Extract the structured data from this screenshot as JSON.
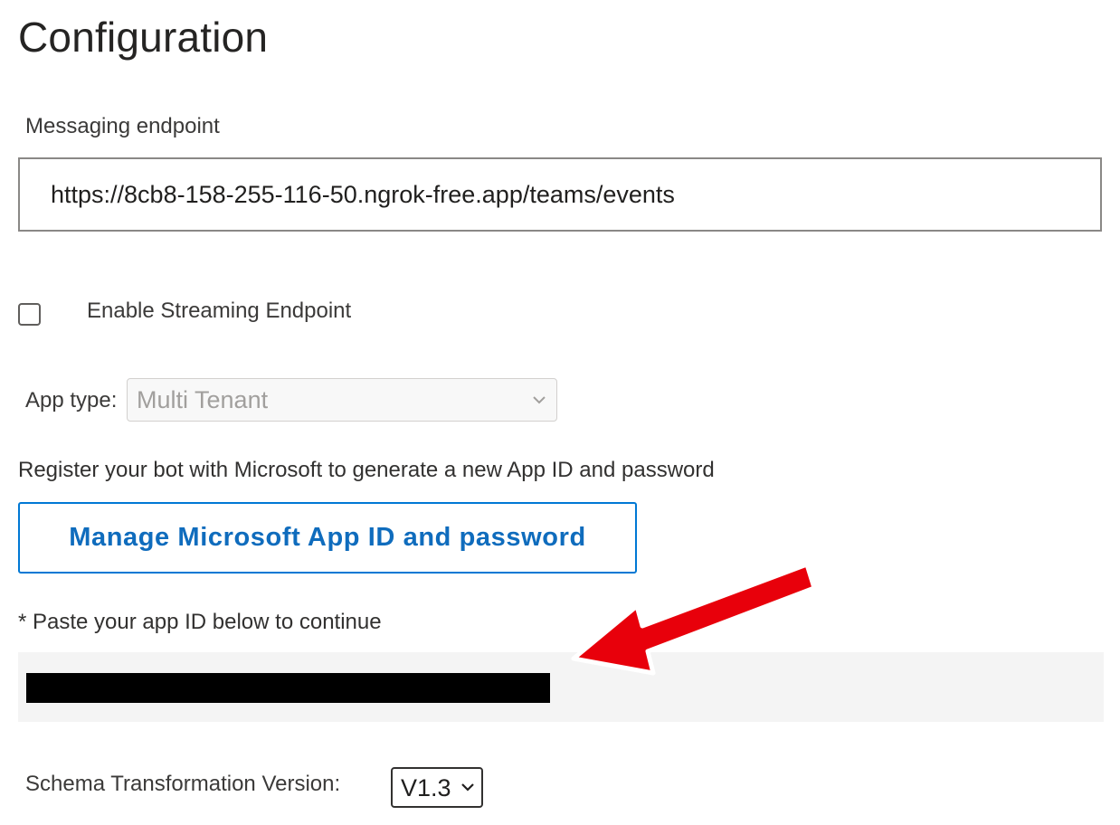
{
  "page": {
    "title": "Configuration"
  },
  "messaging_endpoint": {
    "label": "Messaging endpoint",
    "value": "https://8cb8-158-255-116-50.ngrok-free.app/teams/events"
  },
  "streaming": {
    "label": "Enable Streaming Endpoint",
    "checked": false
  },
  "app_type": {
    "label": "App type:",
    "selected": "Multi Tenant",
    "disabled": true,
    "icon": "chevron-down-icon"
  },
  "register": {
    "text": "Register your bot with Microsoft to generate a new App ID and password",
    "button_label": "Manage Microsoft App ID and password"
  },
  "app_id": {
    "instruction": "* Paste your app ID below to continue",
    "value_redacted": true
  },
  "schema": {
    "label": "Schema Transformation Version:",
    "selected": "V1.3",
    "icon": "chevron-down-icon"
  },
  "annotation": {
    "type": "red-arrow-icon",
    "color": "#e8000b"
  },
  "colors": {
    "accent": "#0078d4",
    "accent_text": "#0f6cbd",
    "text": "#323130",
    "disabled_text": "#a19f9d",
    "field_background": "#f4f4f4"
  }
}
